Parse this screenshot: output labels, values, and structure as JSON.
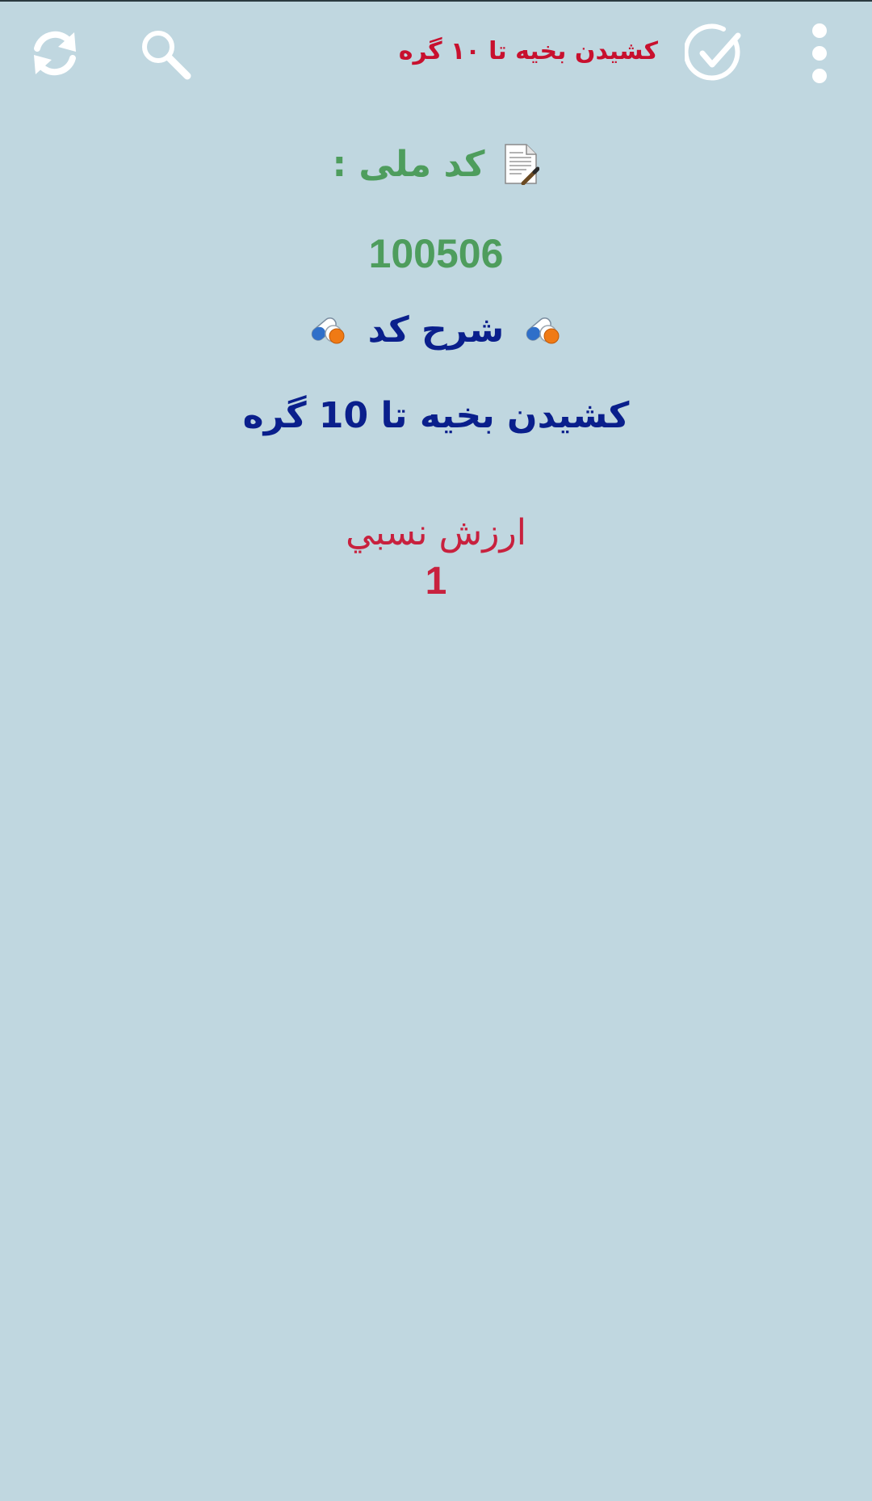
{
  "toolbar": {
    "title": "کشیدن بخیه تا ۱۰ گره",
    "icons": {
      "refresh": "refresh-icon",
      "search": "search-icon",
      "check": "check-circle-icon",
      "more": "more-vert-icon"
    },
    "title_color": "#c8102e"
  },
  "content": {
    "national_code_label": "کد ملی :",
    "national_code_value": "100506",
    "description_label": "شرح کد",
    "description_value": "کشیدن بخیه تا 10 گره",
    "relative_value_label": "ارزش نسبي",
    "relative_value": "1",
    "icons": {
      "document": "document-icon",
      "pills": "pills-icon"
    }
  },
  "colors": {
    "background": "#c0d7e0",
    "code_green": "#4e9d5d",
    "description_blue": "#0a1f8c",
    "value_red": "#c8213e"
  }
}
